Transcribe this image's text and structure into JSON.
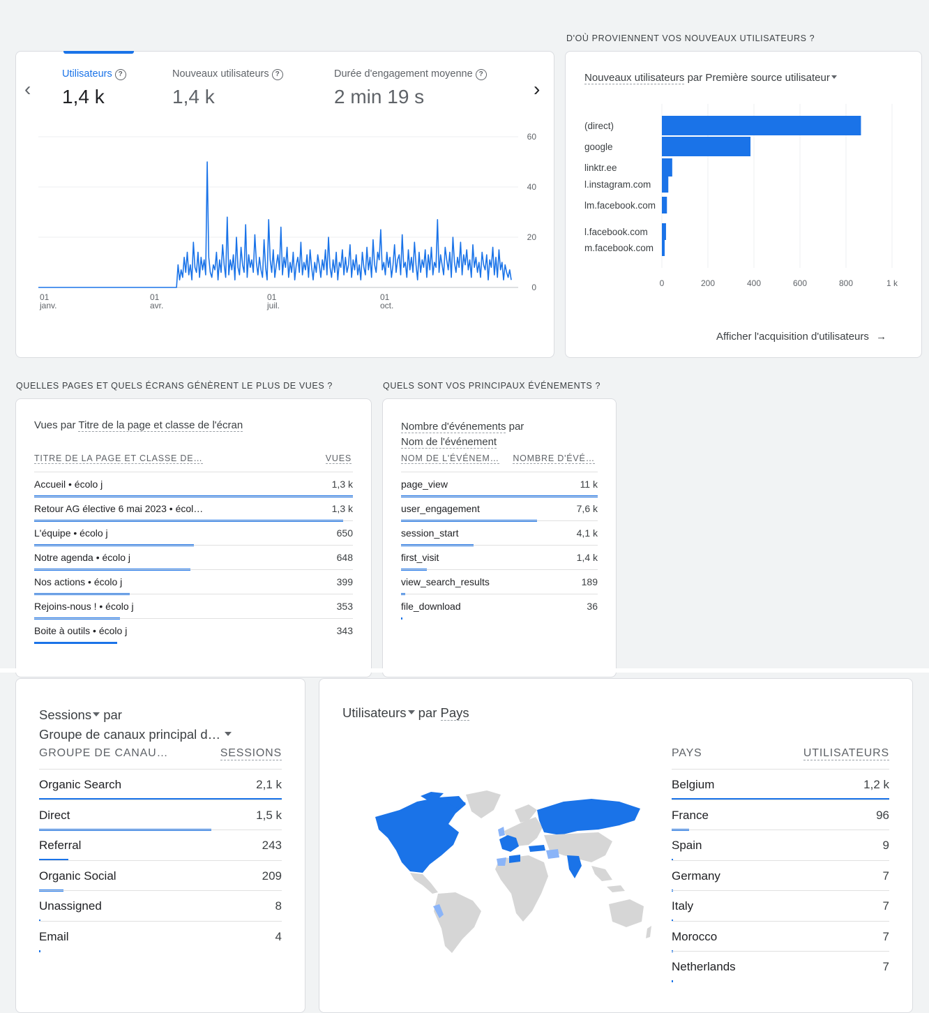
{
  "overview": {
    "metrics": [
      {
        "label": "Utilisateurs",
        "value": "1,4 k"
      },
      {
        "label": "Nouveaux utilisateurs",
        "value": "1,4 k"
      },
      {
        "label": "Durée d'engagement moyenne",
        "value": "2 min 19 s"
      }
    ],
    "help_glyph": "?",
    "prev_glyph": "‹",
    "next_glyph": "›",
    "chart_data": {
      "type": "line",
      "y_ticks": [
        "60",
        "40",
        "20",
        "0"
      ],
      "ylim": [
        0,
        60
      ],
      "x_ticks": [
        {
          "day": "01",
          "month": "janv."
        },
        {
          "day": "01",
          "month": "avr."
        },
        {
          "day": "01",
          "month": "juil."
        },
        {
          "day": "01",
          "month": "oct."
        }
      ],
      "series": [
        {
          "values": [
            0,
            0,
            0,
            0,
            0,
            0,
            0,
            0,
            0,
            0,
            0,
            0,
            0,
            0,
            0,
            0,
            0,
            0,
            0,
            0,
            0,
            0,
            0,
            0,
            0,
            0,
            0,
            0,
            0,
            0,
            0,
            0,
            0,
            0,
            0,
            0,
            0,
            0,
            0,
            0,
            0,
            0,
            0,
            0,
            0,
            0,
            0,
            0,
            0,
            0,
            0,
            0,
            0,
            0,
            0,
            0,
            0,
            0,
            0,
            0,
            0,
            0,
            0,
            0,
            0,
            0,
            0,
            0,
            0,
            0,
            0,
            0,
            0,
            0,
            0,
            0,
            0,
            0,
            0,
            0,
            0,
            0,
            0,
            0,
            0,
            0,
            0,
            0,
            0,
            0,
            0,
            9,
            3,
            7,
            4,
            12,
            6,
            14,
            5,
            9,
            3,
            18,
            8,
            6,
            14,
            4,
            12,
            7,
            11,
            5,
            50,
            12,
            6,
            4,
            9,
            7,
            14,
            3,
            11,
            6,
            17,
            9,
            4,
            28,
            5,
            11,
            7,
            13,
            3,
            20,
            8,
            5,
            16,
            9,
            6,
            25,
            4,
            13,
            8,
            11,
            6,
            21,
            10,
            5,
            12,
            7,
            4,
            19,
            8,
            3,
            27,
            11,
            6,
            15,
            4,
            9,
            13,
            7,
            24,
            5,
            12,
            8,
            16,
            4,
            10,
            6,
            14,
            3,
            9,
            12,
            6,
            18,
            5,
            10,
            7,
            13,
            4,
            15,
            8,
            3,
            10,
            6,
            13,
            9,
            4,
            11,
            7,
            15,
            5,
            20,
            8,
            4,
            11,
            6,
            14,
            3,
            10,
            8,
            15,
            5,
            12,
            6,
            9,
            17,
            4,
            11,
            7,
            13,
            5,
            9,
            3,
            14,
            8,
            5,
            16,
            7,
            12,
            4,
            19,
            9,
            6,
            14,
            11,
            23,
            7,
            10,
            5,
            14,
            8,
            12,
            4,
            9,
            17,
            6,
            11,
            13,
            5,
            21,
            8,
            10,
            4,
            15,
            7,
            12,
            6,
            18,
            9,
            3,
            14,
            6,
            11,
            8,
            15,
            4,
            13,
            7,
            16,
            5,
            10,
            8,
            27,
            6,
            13,
            9,
            5,
            16,
            11,
            7,
            14,
            4,
            20,
            10,
            6,
            12,
            8,
            18,
            5,
            13,
            9,
            15,
            7,
            11,
            4,
            17,
            8,
            12,
            6,
            10,
            4,
            14,
            9,
            7,
            13,
            3,
            11,
            8,
            16,
            5,
            12,
            4,
            15,
            7,
            10,
            3,
            9,
            6,
            4,
            7,
            3
          ]
        }
      ]
    }
  },
  "sources": {
    "section_title": "D'OÙ PROVIENNENT VOS NOUVEAUX UTILISATEURS ?",
    "card_title_a": "Nouveaux utilisateurs",
    "card_title_b": " par Première source utilisateur",
    "link": "Afficher l'acquisition d'utilisateurs",
    "chart_data": {
      "type": "bar",
      "orientation": "horizontal",
      "categories": [
        "(direct)",
        "google",
        "linktr.ee",
        "l.instagram.com",
        "lm.facebook.com",
        "l.facebook.com",
        "m.facebook.com"
      ],
      "values": [
        865,
        385,
        45,
        28,
        22,
        18,
        12
      ],
      "xlim": [
        0,
        1000
      ],
      "x_ticks": [
        "0",
        "200",
        "400",
        "600",
        "800",
        "1 k"
      ],
      "bar_color": "#1a73e8"
    }
  },
  "pages": {
    "section_title": "QUELLES PAGES ET QUELS ÉCRANS GÉNÈRENT LE PLUS DE VUES ?",
    "card_title_a": "Vues par ",
    "card_title_b": "Titre de la page et classe de l'écran",
    "col1": "TITRE DE LA PAGE ET CLASSE DE…",
    "col2": "VUES",
    "rows": [
      {
        "label": "Accueil • écolo j",
        "value": "1,3 k",
        "pct": 1.0
      },
      {
        "label": "Retour AG élective 6 mai 2023 • écol…",
        "value": "1,3 k",
        "pct": 0.97
      },
      {
        "label": "L'équipe • écolo j",
        "value": "650",
        "pct": 0.5
      },
      {
        "label": "Notre agenda • écolo j",
        "value": "648",
        "pct": 0.49
      },
      {
        "label": "Nos actions • écolo j",
        "value": "399",
        "pct": 0.3
      },
      {
        "label": "Rejoins-nous ! • écolo j",
        "value": "353",
        "pct": 0.27
      },
      {
        "label": "Boite à outils • écolo j",
        "value": "343",
        "pct": 0.26
      }
    ]
  },
  "events": {
    "section_title": "QUELS SONT VOS PRINCIPAUX ÉVÉNEMENTS ?",
    "card_title_a": "Nombre d'événements",
    "card_title_b": " par",
    "card_title_c": "Nom de l'événement",
    "col1": "NOM DE L'ÉVÉNEM…",
    "col2": "NOMBRE D'ÉVÉ…",
    "rows": [
      {
        "label": "page_view",
        "value": "11 k",
        "pct": 1.0
      },
      {
        "label": "user_engagement",
        "value": "7,6 k",
        "pct": 0.69
      },
      {
        "label": "session_start",
        "value": "4,1 k",
        "pct": 0.37
      },
      {
        "label": "first_visit",
        "value": "1,4 k",
        "pct": 0.13
      },
      {
        "label": "view_search_results",
        "value": "189",
        "pct": 0.02
      },
      {
        "label": "file_download",
        "value": "36",
        "pct": 0.005
      }
    ]
  },
  "channels": {
    "title_a": "Sessions",
    "title_b": " par",
    "title_c": "Groupe de canaux principal d…",
    "col1": "GROUPE DE CANAU…",
    "col2": "SESSIONS",
    "rows": [
      {
        "label": "Organic Search",
        "value": "2,1 k",
        "pct": 1.0
      },
      {
        "label": "Direct",
        "value": "1,5 k",
        "pct": 0.71
      },
      {
        "label": "Referral",
        "value": "243",
        "pct": 0.12
      },
      {
        "label": "Organic Social",
        "value": "209",
        "pct": 0.1
      },
      {
        "label": "Unassigned",
        "value": "8",
        "pct": 0.004
      },
      {
        "label": "Email",
        "value": "4",
        "pct": 0.002
      }
    ]
  },
  "countries": {
    "title_a": "Utilisateurs",
    "title_b": " par ",
    "title_c": "Pays",
    "col1": "PAYS",
    "col2": "UTILISATEURS",
    "rows": [
      {
        "label": "Belgium",
        "value": "1,2 k",
        "pct": 1.0
      },
      {
        "label": "France",
        "value": "96",
        "pct": 0.08
      },
      {
        "label": "Spain",
        "value": "9",
        "pct": 0.008
      },
      {
        "label": "Germany",
        "value": "7",
        "pct": 0.006
      },
      {
        "label": "Italy",
        "value": "7",
        "pct": 0.006
      },
      {
        "label": "Morocco",
        "value": "7",
        "pct": 0.006
      },
      {
        "label": "Netherlands",
        "value": "7",
        "pct": 0.006
      }
    ]
  },
  "colors": {
    "accent": "#1a73e8",
    "map_grey": "#d6d6d6",
    "map_light": "#8ab4f8"
  }
}
